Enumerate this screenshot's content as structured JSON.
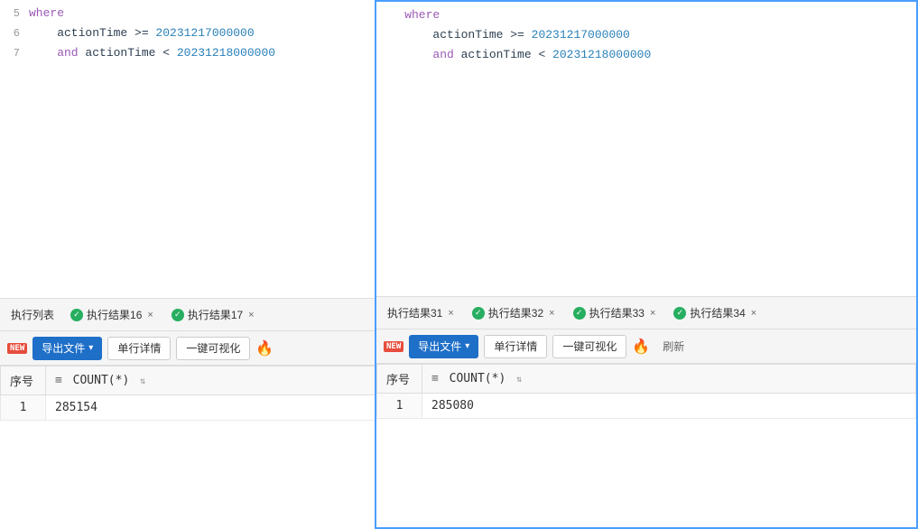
{
  "leftPanel": {
    "codeLines": [
      {
        "lineNum": "5",
        "content": "where",
        "type": "keyword-where"
      },
      {
        "lineNum": "6",
        "indent": "    ",
        "fieldPart": "actionTime",
        "opPart": " >=",
        "valPart": " 20231217000000",
        "type": "condition"
      },
      {
        "lineNum": "7",
        "kwPart": "    and ",
        "fieldPart": "actionTime",
        "opPart": " <",
        "valPart": " 20231218000000",
        "type": "and-condition"
      }
    ],
    "tabs": [
      {
        "label": "执行列表",
        "hasClose": false,
        "hasCheck": false
      },
      {
        "label": "执行结果16",
        "hasClose": true,
        "hasCheck": true
      },
      {
        "label": "执行结果17",
        "hasClose": true,
        "hasCheck": true
      }
    ],
    "toolbar": {
      "exportLabel": "导出文件",
      "detailLabel": "单行详情",
      "visualLabel": "一键可视化"
    },
    "table": {
      "columns": [
        "序号",
        "COUNT(*)"
      ],
      "rows": [
        {
          "num": "1",
          "count": "285154"
        }
      ]
    }
  },
  "rightPanel": {
    "codeLines": [
      {
        "lineNum": "",
        "content": "where",
        "type": "keyword-where"
      },
      {
        "lineNum": "",
        "indent": "    ",
        "fieldPart": "actionTime",
        "opPart": " >=",
        "valPart": " 20231217000000",
        "type": "condition"
      },
      {
        "lineNum": "",
        "kwPart": "    and ",
        "fieldPart": "actionTime",
        "opPart": " <",
        "valPart": " 20231218000000",
        "type": "and-condition"
      }
    ],
    "tabs": [
      {
        "label": "执行结果31",
        "hasClose": true,
        "hasCheck": false
      },
      {
        "label": "执行结果32",
        "hasClose": true,
        "hasCheck": true
      },
      {
        "label": "执行结果33",
        "hasClose": true,
        "hasCheck": true
      },
      {
        "label": "执行结果34",
        "hasClose": true,
        "hasCheck": true
      }
    ],
    "toolbar": {
      "exportLabel": "导出文件",
      "detailLabel": "单行详情",
      "visualLabel": "一键可视化",
      "refreshLabel": "刷新"
    },
    "table": {
      "columns": [
        "序号",
        "COUNT(*)"
      ],
      "rows": [
        {
          "num": "1",
          "count": "285080"
        }
      ]
    }
  },
  "icons": {
    "check": "✓",
    "dropdown": "▾",
    "fire": "🔥",
    "sort": "⇅",
    "list": "≡",
    "refresh": "↺"
  }
}
